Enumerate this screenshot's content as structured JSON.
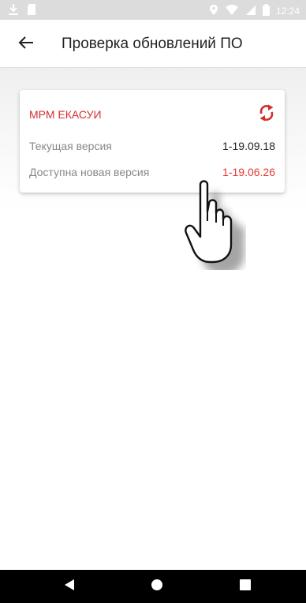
{
  "status_bar": {
    "time": "12:24",
    "icons": [
      "download-icon",
      "sd-card-icon",
      "location-icon",
      "wifi-icon",
      "signal-icon",
      "battery-icon"
    ]
  },
  "app_bar": {
    "back_icon": "arrow-left-icon",
    "title": "Проверка обновлений ПО"
  },
  "card": {
    "title": "МРМ ЕКАСУИ",
    "refresh_icon": "refresh-icon",
    "rows": [
      {
        "label": "Текущая версия",
        "value": "1-19.09.18"
      },
      {
        "label": "Доступна новая версия",
        "value": "1-19.06.26"
      }
    ]
  },
  "nav_bar": {
    "buttons": [
      "back-triangle-icon",
      "home-circle-icon",
      "recents-square-icon"
    ]
  },
  "colors": {
    "accent": "#d32f2f",
    "new_version": "#e53935",
    "label": "#888888",
    "status_bar": "#dcdcdc"
  }
}
